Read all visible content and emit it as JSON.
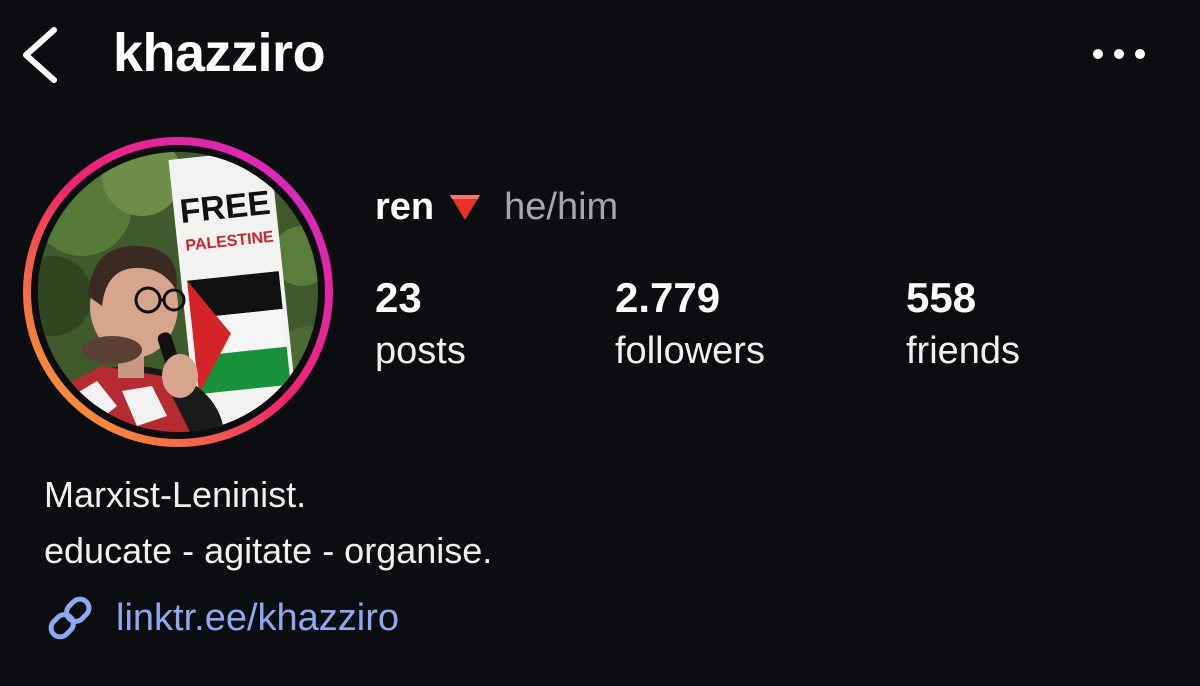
{
  "header": {
    "username": "khazziro",
    "back_icon": "chevron-left-icon",
    "more_icon": "more-horizontal-icon"
  },
  "profile": {
    "avatar_icon": "avatar",
    "display_name": "ren",
    "flag_emoji": "red-triangle-down-icon",
    "pronouns": "he/him",
    "avatar_sign_text": [
      "FREE",
      "PALESTINE"
    ]
  },
  "stats": [
    {
      "value": "23",
      "label": "posts"
    },
    {
      "value": "2.779",
      "label": "followers"
    },
    {
      "value": "558",
      "label": "friends"
    }
  ],
  "bio": {
    "lines": [
      "Marxist-Leninist.",
      "educate - agitate - organise."
    ]
  },
  "link": {
    "icon": "link-icon",
    "text": "linktr.ee/khazziro"
  },
  "colors": {
    "background": "#0c0d10",
    "link": "#8fa8f0",
    "pronouns": "#a4a7ad",
    "ring_start": "#f7b526",
    "ring_mid": "#f0246c",
    "ring_end": "#d22ad6"
  }
}
